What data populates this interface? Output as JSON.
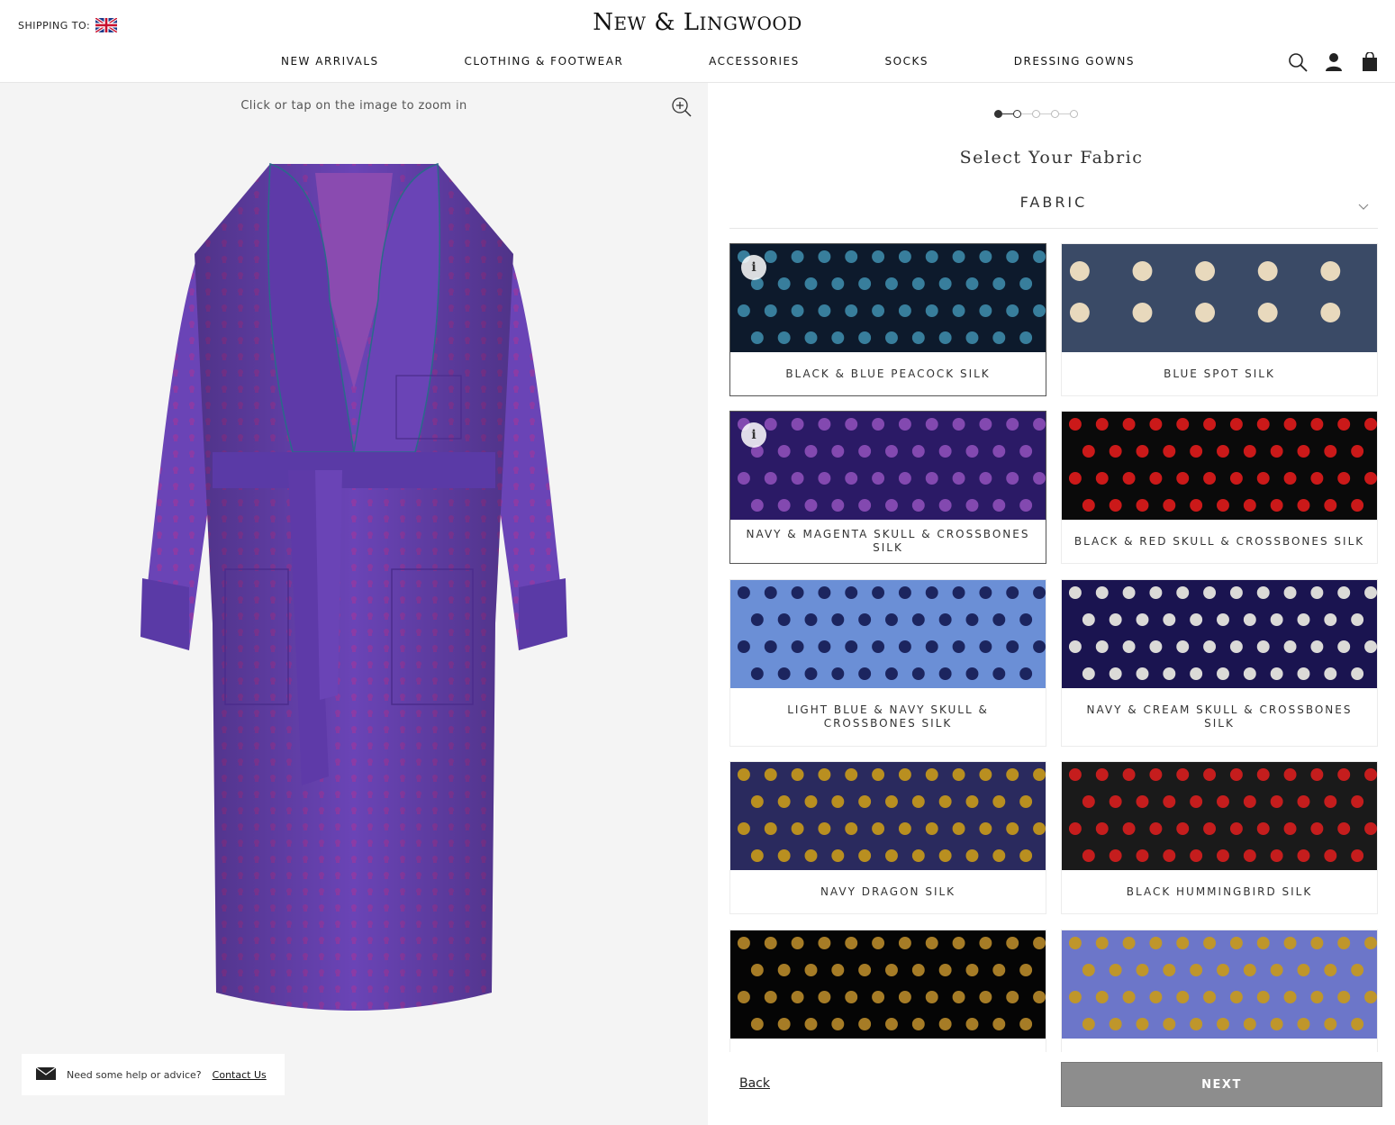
{
  "header": {
    "shipping_label": "SHIPPING TO:",
    "shipping_country_icon": "uk-flag-icon",
    "logo_pre": "N",
    "logo_sc1": "EW",
    "logo_amp": " & ",
    "logo_l": "L",
    "logo_sc2": "INGWOOD",
    "nav": [
      "NEW ARRIVALS",
      "CLOTHING & FOOTWEAR",
      "ACCESSORIES",
      "SOCKS",
      "DRESSING GOWNS"
    ],
    "icons": [
      "search-icon",
      "account-icon",
      "bag-icon"
    ]
  },
  "left": {
    "zoom_hint": "Click or tap on the image to zoom in",
    "help_text": "Need some help or advice?",
    "help_link": "Contact Us"
  },
  "configurator": {
    "step_current": 2,
    "step_total": 5,
    "title": "Select Your Fabric",
    "section_label": "FABRIC",
    "fabrics": [
      {
        "name": "BLACK & BLUE PEACOCK SILK",
        "selected": true,
        "info": true,
        "bg": "#0d1a2c",
        "fg": "#3d8aa8"
      },
      {
        "name": "BLUE SPOT SILK",
        "selected": false,
        "info": false,
        "bg": "#3a4a66",
        "fg": "#e8d9bd"
      },
      {
        "name": "NAVY & MAGENTA SKULL & CROSSBONES SILK",
        "selected": true,
        "info": true,
        "bg": "#2b1a66",
        "fg": "#8d4fb8"
      },
      {
        "name": "BLACK & RED SKULL & CROSSBONES SILK",
        "selected": false,
        "info": false,
        "bg": "#0a0a0a",
        "fg": "#e01b1b"
      },
      {
        "name": "LIGHT BLUE & NAVY SKULL & CROSSBONES SILK",
        "selected": false,
        "info": false,
        "bg": "#6b8fd6",
        "fg": "#141a52"
      },
      {
        "name": "NAVY & CREAM SKULL & CROSSBONES SILK",
        "selected": false,
        "info": false,
        "bg": "#1a1450",
        "fg": "#f1efe6"
      },
      {
        "name": "NAVY DRAGON SILK",
        "selected": false,
        "info": false,
        "bg": "#2a2a5e",
        "fg": "#c99a1a"
      },
      {
        "name": "BLACK HUMMINGBIRD SILK",
        "selected": false,
        "info": false,
        "bg": "#1a1a1a",
        "fg": "#d81e1e"
      },
      {
        "name": "",
        "selected": false,
        "info": false,
        "bg": "#050505",
        "fg": "#b88a2a"
      },
      {
        "name": "",
        "selected": false,
        "info": false,
        "bg": "#6c76c9",
        "fg": "#c99a1a"
      }
    ],
    "back_label": "Back",
    "next_label": "NEXT"
  },
  "colors": {
    "robe": "#6a44b6",
    "robe_dark": "#4b2c8c",
    "robe_pattern": "#8b3ba6",
    "next_button": "#8d8d8d",
    "left_bg": "#f4f4f4"
  }
}
